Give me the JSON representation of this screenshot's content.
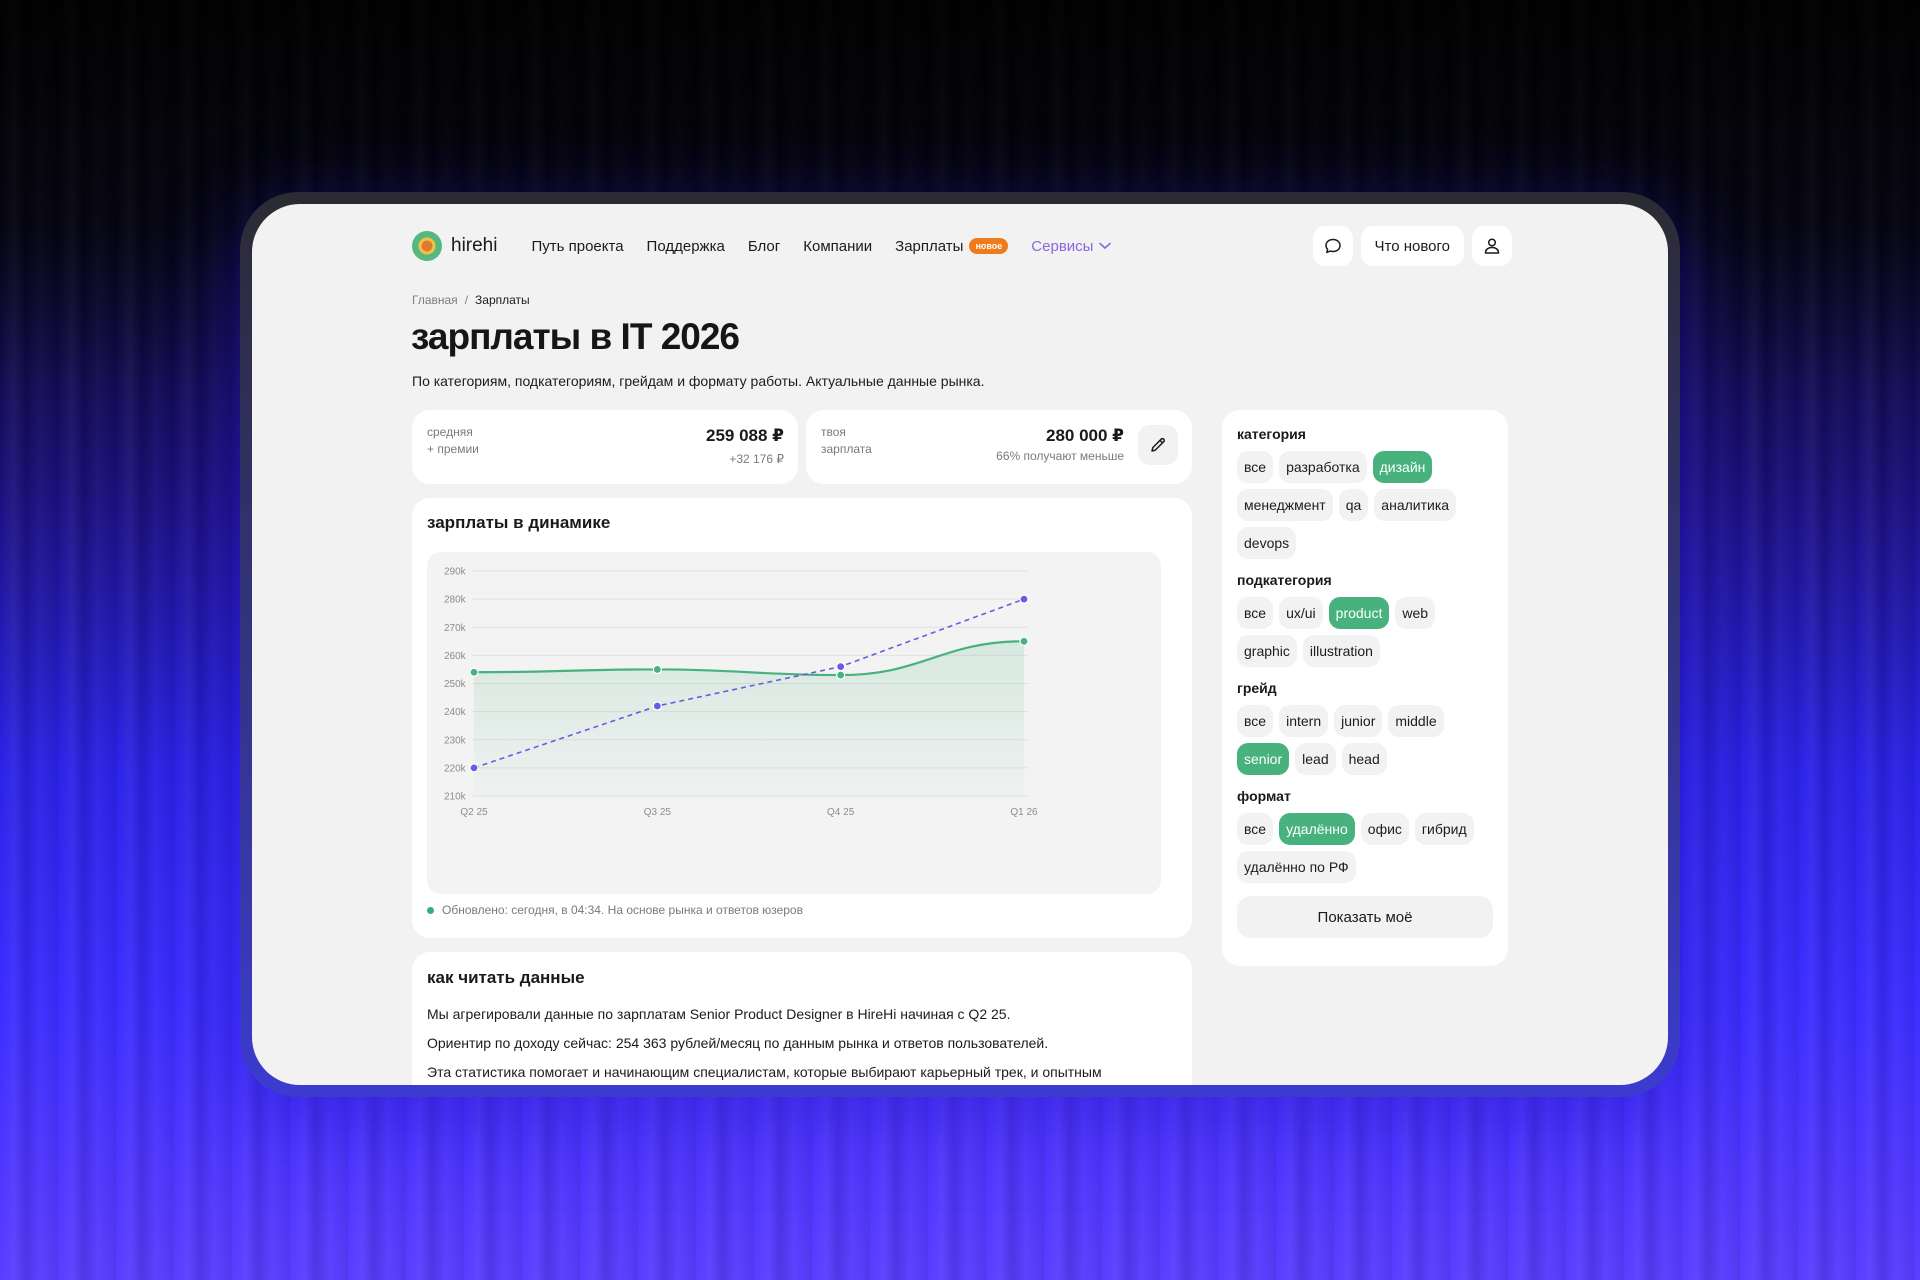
{
  "nav": {
    "logo": "hirehi",
    "links": [
      "Путь проекта",
      "Поддержка",
      "Блог",
      "Компании",
      "Зарплаты"
    ],
    "salary_badge": "новое",
    "services": "Сервисы",
    "whats_new": "Что нового"
  },
  "breadcrumb": {
    "home": "Главная",
    "separator": "/",
    "current": "Зарплаты"
  },
  "page": {
    "title": "зарплаты в IT 2026",
    "subtitle": "По категориям, подкатегориям, грейдам и формату работы. Актуальные данные рынка."
  },
  "stats": {
    "average": {
      "label_1": "средняя",
      "label_2": "+ премии",
      "value": "259 088 ₽",
      "note": "+32 176 ₽"
    },
    "yours": {
      "label_1": "твоя",
      "label_2": "зарплата",
      "value": "280 000 ₽",
      "note": "66% получают меньше"
    }
  },
  "chart_card": {
    "title": "зарплаты в динамике",
    "updated": "Обновлено: сегодня, в 04:34. На основе рынка и ответов юзеров"
  },
  "chart_data": {
    "type": "line",
    "categories": [
      "Q2 25",
      "Q3 25",
      "Q4 25",
      "Q1 26"
    ],
    "y_ticks": [
      "290k",
      "280k",
      "270k",
      "260k",
      "250k",
      "240k",
      "230k",
      "220k",
      "210k"
    ],
    "ylim": [
      210,
      290
    ],
    "grid": true,
    "series": [
      {
        "style": "solid-area",
        "color": "#47b27e",
        "values": [
          254,
          255,
          253,
          265
        ]
      },
      {
        "style": "dashed",
        "color": "#6a5ae0",
        "values": [
          220,
          242,
          256,
          280
        ]
      }
    ]
  },
  "read_card": {
    "title": "как читать данные",
    "lines": [
      "Мы агрегировали данные по зарплатам Senior Product Designer в HireHi начиная с Q2 25.",
      "Ориентир по доходу сейчас: 254 363 рублей/месяц по данным рынка и ответов пользователей.",
      "Эта статистика помогает и начинающим специалистам, которые выбирают карьерный трек, и опытным"
    ]
  },
  "filters": {
    "groups": [
      {
        "label": "категория",
        "chips": [
          "все",
          "разработка",
          "дизайн",
          "менеджмент",
          "qa",
          "аналитика",
          "devops"
        ],
        "active": "дизайн"
      },
      {
        "label": "подкатегория",
        "chips": [
          "все",
          "ux/ui",
          "product",
          "web",
          "graphic",
          "illustration"
        ],
        "active": "product"
      },
      {
        "label": "грейд",
        "chips": [
          "все",
          "intern",
          "junior",
          "middle",
          "senior",
          "lead",
          "head"
        ],
        "active": "senior"
      },
      {
        "label": "формат",
        "chips": [
          "все",
          "удалённо",
          "офис",
          "гибрид",
          "удалённо по РФ"
        ],
        "active": "удалённо"
      }
    ],
    "show_button": "Показать моё"
  },
  "colors": {
    "accent_green": "#47b27e",
    "accent_purple": "#6a5ae0",
    "badge_orange": "#f07b1a"
  }
}
